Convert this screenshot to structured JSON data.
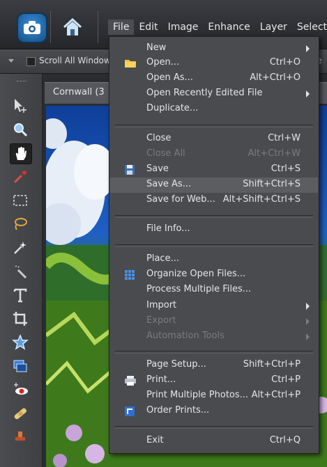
{
  "menubar": {
    "items": [
      {
        "label": "File",
        "active": true
      },
      {
        "label": "Edit"
      },
      {
        "label": "Image"
      },
      {
        "label": "Enhance"
      },
      {
        "label": "Layer"
      },
      {
        "label": "Select"
      }
    ]
  },
  "options_bar": {
    "scroll_all_label": "Scroll All Windows",
    "right_text": "ze"
  },
  "document": {
    "tab_title": "Cornwall (3"
  },
  "tools": [
    "move",
    "zoom",
    "hand",
    "eyedropper",
    "marquee",
    "lasso",
    "magic-wand",
    "quick-selection",
    "type",
    "crop",
    "shape",
    "redeye",
    "healing"
  ],
  "file_menu": {
    "items": [
      {
        "label": "New",
        "submenu": true
      },
      {
        "label": "Open...",
        "shortcut": "Ctrl+O",
        "icon": "folder-icon"
      },
      {
        "label": "Open As...",
        "shortcut": "Alt+Ctrl+O"
      },
      {
        "label": "Open Recently Edited File",
        "submenu": true
      },
      {
        "label": "Duplicate..."
      },
      {
        "label": "Close",
        "shortcut": "Ctrl+W"
      },
      {
        "label": "Close All",
        "shortcut": "Alt+Ctrl+W",
        "disabled": true
      },
      {
        "label": "Save",
        "shortcut": "Ctrl+S",
        "icon": "floppy-disk-icon"
      },
      {
        "label": "Save As...",
        "shortcut": "Shift+Ctrl+S",
        "highlighted": true
      },
      {
        "label": "Save for Web...",
        "shortcut": "Alt+Shift+Ctrl+S"
      },
      {
        "label": "File Info..."
      },
      {
        "label": "Place..."
      },
      {
        "label": "Organize Open Files...",
        "icon": "grid-icon"
      },
      {
        "label": "Process Multiple Files..."
      },
      {
        "label": "Import",
        "submenu": true
      },
      {
        "label": "Export",
        "submenu": true,
        "disabled": true
      },
      {
        "label": "Automation Tools",
        "submenu": true,
        "disabled": true
      },
      {
        "label": "Page Setup...",
        "shortcut": "Shift+Ctrl+P"
      },
      {
        "label": "Print...",
        "shortcut": "Ctrl+P",
        "icon": "printer-icon"
      },
      {
        "label": "Print Multiple Photos...",
        "shortcut": "Alt+Ctrl+P"
      },
      {
        "label": "Order Prints...",
        "icon": "order-prints-icon"
      },
      {
        "label": "Exit",
        "shortcut": "Ctrl+Q"
      }
    ]
  }
}
